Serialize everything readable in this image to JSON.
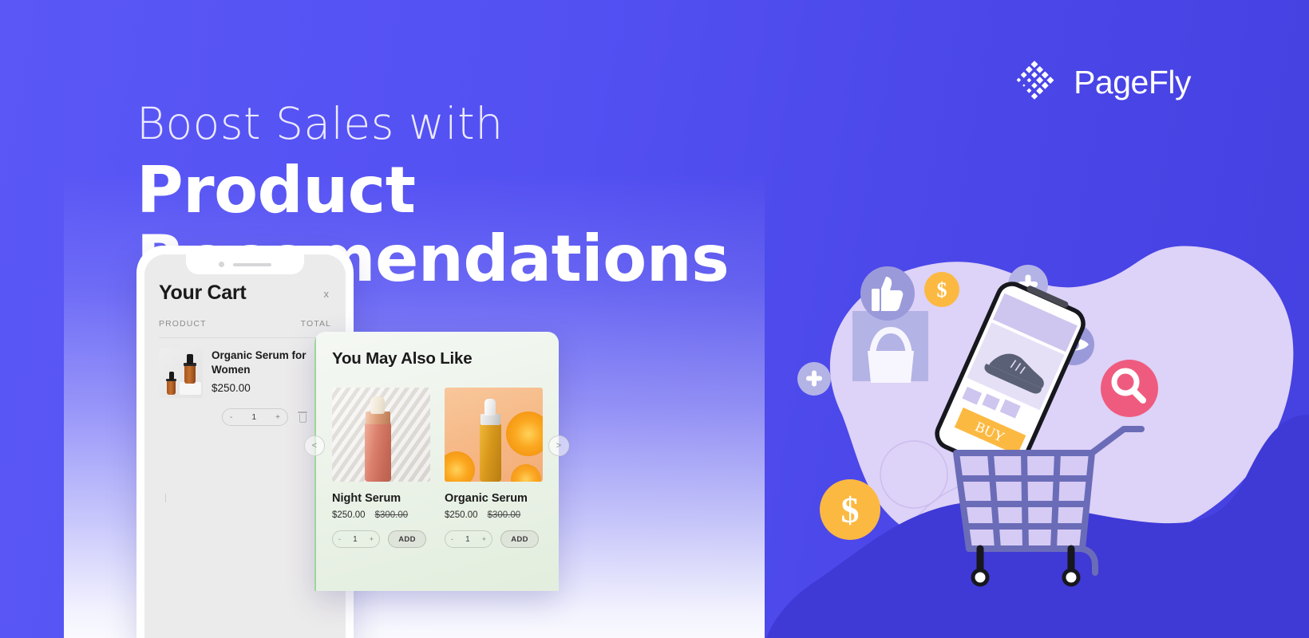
{
  "brand": {
    "name": "PageFly",
    "logo_icon": "pagefly-diamond-logo",
    "logo_color": "#ffffff"
  },
  "headline": {
    "line1": "Boost Sales with",
    "line2": "Product Recomendations"
  },
  "colors": {
    "background_blue": "#5956f5",
    "background_blue_dark": "#4540e0",
    "card_green": "#eaf2e7",
    "accent_pink": "#ef5b7e",
    "accent_yellow": "#fcb941",
    "lavender": "#d9cdf5",
    "icon_periwinkle": "#9a9ada"
  },
  "phone": {
    "notch_icon": "phone-notch",
    "cart": {
      "title": "Your Cart",
      "close_label": "x",
      "column_product": "PRODUCT",
      "column_total": "TOTAL",
      "item": {
        "name": "Organic Serum for Women",
        "price": "$250.00",
        "thumbnail_icon": "serum-bottles-thumbnail",
        "quantity": "1",
        "decrement_label": "-",
        "increment_label": "+",
        "remove_icon": "trash-icon"
      }
    }
  },
  "recommendation_card": {
    "title": "You May Also Like",
    "prev_label": "<",
    "next_label": ">",
    "products": [
      {
        "name": "Night Serum",
        "price": "$250.00",
        "compare_at_price": "$300.00",
        "quantity": "1",
        "decrement_label": "-",
        "increment_label": "+",
        "add_label": "ADD",
        "image_icon": "night-serum-photo"
      },
      {
        "name": "Organic Serum",
        "price": "$250.00",
        "compare_at_price": "$300.00",
        "quantity": "1",
        "decrement_label": "-",
        "increment_label": "+",
        "add_label": "ADD",
        "image_icon": "organic-serum-orange-photo"
      }
    ]
  },
  "illustration": {
    "phone_buy_label": "BUY",
    "coin_label": "$",
    "big_coin_label": "$",
    "plus_label": "+",
    "icons": [
      "thumbs-up-icon",
      "dollar-coin-icon",
      "plus-circle-icon",
      "eye-icon",
      "search-icon",
      "shopping-bag-icon",
      "shopping-cart-icon",
      "smartphone-icon",
      "shoe-icon"
    ]
  }
}
